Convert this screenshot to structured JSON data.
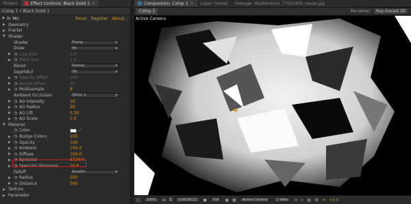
{
  "left_tabs": {
    "project": "Project",
    "effect_controls": "Effect Controls: Black Solid 1"
  },
  "right_tabs": {
    "composition": "Composition: Comp 1",
    "layer": "Layer: (none)",
    "footage": "Footage: shutterstock_77022403_resize.jpg"
  },
  "breadcrumb": "Comp 1 • Black Solid 1",
  "effect": {
    "fx": "fx",
    "name": "Mir",
    "reset": "Reset",
    "register": "Register",
    "about": "About..."
  },
  "props": [
    {
      "label": "Geometry",
      "indent": 0,
      "tw": true
    },
    {
      "label": "Fractal",
      "indent": 0,
      "tw": true
    },
    {
      "label": "Shader",
      "indent": 0,
      "tw": true,
      "open": true
    },
    {
      "label": "Shader",
      "indent": 1,
      "dd": "Phong"
    },
    {
      "label": "Draw",
      "indent": 1,
      "dd": "Fill"
    },
    {
      "label": "Line Size",
      "indent": 1,
      "val": "1.0",
      "tw": true,
      "sw": true,
      "dim": true
    },
    {
      "label": "Point Size",
      "indent": 1,
      "val": "1.0",
      "tw": true,
      "sw": true,
      "dim": true
    },
    {
      "label": "Blend",
      "indent": 1,
      "dd": "Normal"
    },
    {
      "label": "DepthBuf",
      "indent": 1,
      "dd": "Off"
    },
    {
      "label": "Opacity Affect",
      "indent": 1,
      "val": "100",
      "tw": true,
      "sw": true,
      "dim": true
    },
    {
      "label": "Accum Affect",
      "indent": 1,
      "val": "60",
      "tw": true,
      "sw": true,
      "dim": true
    },
    {
      "label": "Multisample",
      "indent": 1,
      "val": "8",
      "tw": true,
      "sw": true
    },
    {
      "label": "Ambient Occlusion",
      "indent": 1,
      "dd": "Dither 2"
    },
    {
      "label": "AO Intensity",
      "indent": 1,
      "val": "10",
      "tw": true,
      "sw": true
    },
    {
      "label": "AO Radius",
      "indent": 1,
      "val": "20",
      "tw": true,
      "sw": true
    },
    {
      "label": "AO Lift",
      "indent": 1,
      "val": "0.20",
      "tw": true,
      "sw": true
    },
    {
      "label": "AO Scale",
      "indent": 1,
      "val": "1.0",
      "tw": true,
      "sw": true
    },
    {
      "label": "Material",
      "indent": 0,
      "tw": true,
      "open": true
    },
    {
      "label": "Color",
      "indent": 1,
      "color": "#ffffff",
      "sw": true
    },
    {
      "label": "Nudge Colors",
      "indent": 1,
      "val": "100",
      "tw": true,
      "sw": true
    },
    {
      "label": "Opacity",
      "indent": 1,
      "val": "100",
      "tw": true,
      "sw": true
    },
    {
      "label": "Ambient",
      "indent": 1,
      "val": "100.0",
      "tw": true,
      "sw": true
    },
    {
      "label": "Diffuse",
      "indent": 1,
      "val": "100.0",
      "tw": true,
      "sw": true
    },
    {
      "label": "Specular",
      "indent": 1,
      "val": "3720.0",
      "tw": true,
      "sw": true
    },
    {
      "label": "Specular Shininess",
      "indent": 1,
      "val": "10.0",
      "tw": true,
      "sw": true
    },
    {
      "label": "Falloff",
      "indent": 1,
      "dd": "Smooth"
    },
    {
      "label": "Radius",
      "indent": 1,
      "val": "500",
      "tw": true,
      "sw": true
    },
    {
      "label": "Distance",
      "indent": 1,
      "val": "500",
      "tw": true,
      "sw": true
    },
    {
      "label": "Texture",
      "indent": 0,
      "tw": true
    },
    {
      "label": "Parameter",
      "indent": 0,
      "tw": true
    }
  ],
  "comp_tab": "Comp 1",
  "renderer": {
    "label": "Renderer:",
    "value": "Ray-traced 3D"
  },
  "viewer": {
    "camera": "Active Camera"
  },
  "bottom": {
    "zoom": "100%",
    "timecode": "0;00;00;21",
    "resolution": "Full",
    "camera": "Active Camera",
    "views": "1 View",
    "exposure": "+0.0"
  },
  "colors": {
    "accent": "#d59a26",
    "highlight": "#d42020"
  }
}
